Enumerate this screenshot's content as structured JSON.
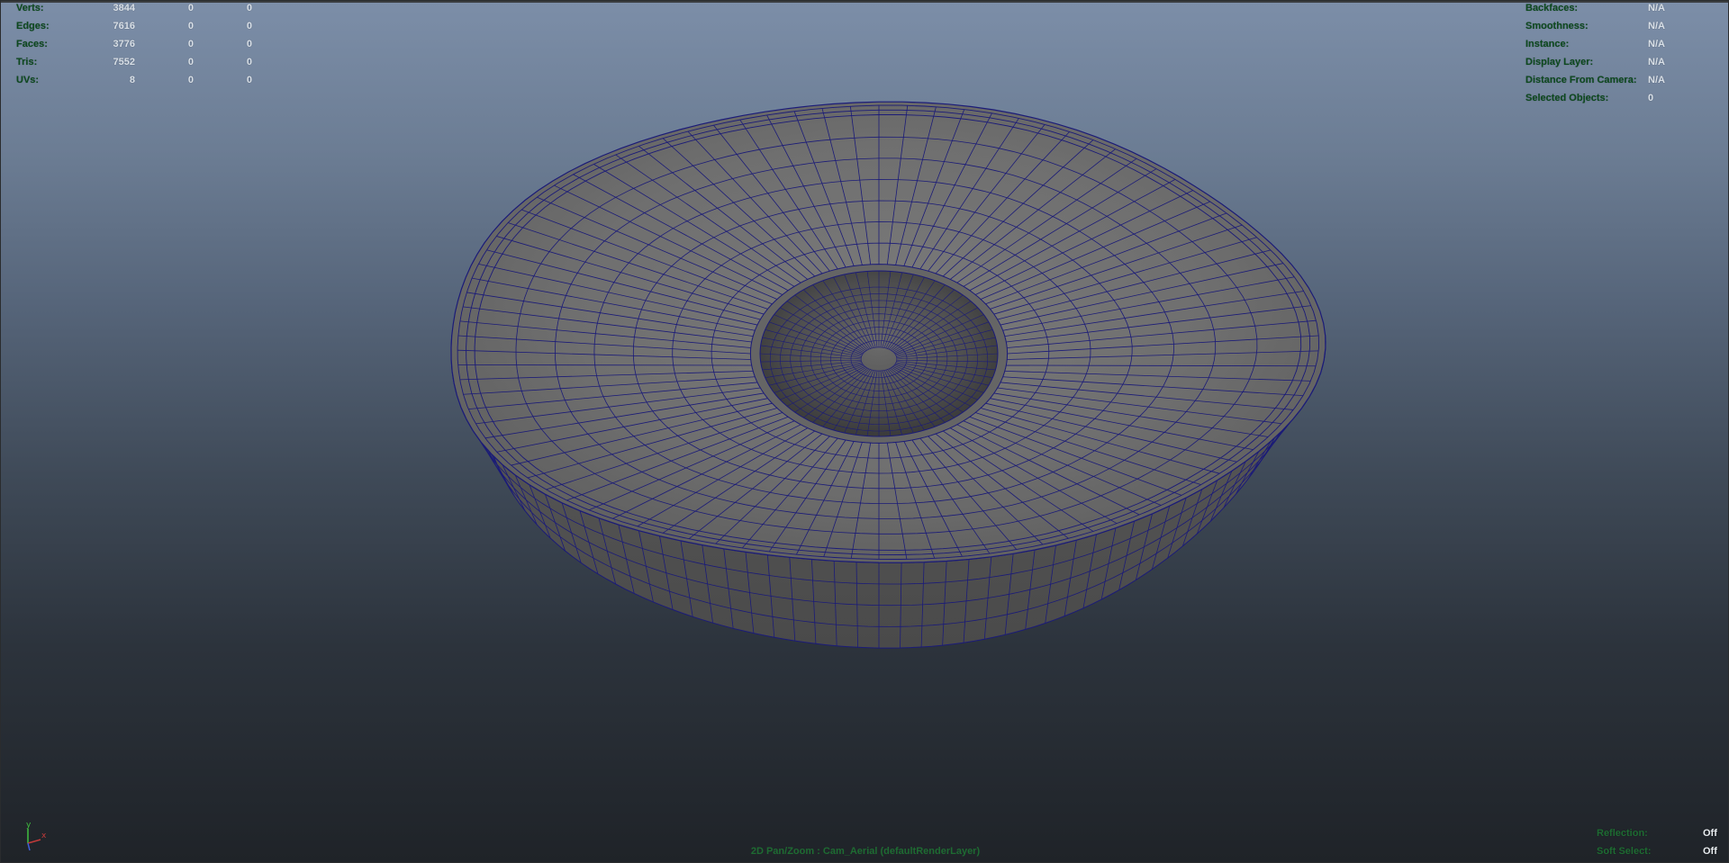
{
  "stats": {
    "rows": [
      {
        "label": "Verts:",
        "values": [
          "3844",
          "0",
          "0"
        ]
      },
      {
        "label": "Edges:",
        "values": [
          "7616",
          "0",
          "0"
        ]
      },
      {
        "label": "Faces:",
        "values": [
          "3776",
          "0",
          "0"
        ]
      },
      {
        "label": "Tris:",
        "values": [
          "7552",
          "0",
          "0"
        ]
      },
      {
        "label": "UVs:",
        "values": [
          "8",
          "0",
          "0"
        ]
      }
    ]
  },
  "object_info": {
    "rows": [
      {
        "label": "Backfaces:",
        "value": "N/A"
      },
      {
        "label": "Smoothness:",
        "value": "N/A"
      },
      {
        "label": "Instance:",
        "value": "N/A"
      },
      {
        "label": "Display Layer:",
        "value": "N/A"
      },
      {
        "label": "Distance From Camera:",
        "value": "N/A"
      },
      {
        "label": "Selected Objects:",
        "value": "0"
      }
    ]
  },
  "viewport_status": {
    "rows": [
      {
        "label": "Reflection:",
        "value": "Off"
      },
      {
        "label": "Soft Select:",
        "value": "Off"
      }
    ]
  },
  "camera_label": "2D Pan/Zoom : Cam_Aerial (defaultRenderLayer)",
  "axis": {
    "y": "y",
    "x": "x"
  },
  "colors": {
    "mesh_fill": "#6d6d6d",
    "wire": "#1b1b78",
    "hud_label": "#0d4a1f",
    "hud_value": "#d9e0e8"
  },
  "icons": [
    "view-axis-icon"
  ]
}
